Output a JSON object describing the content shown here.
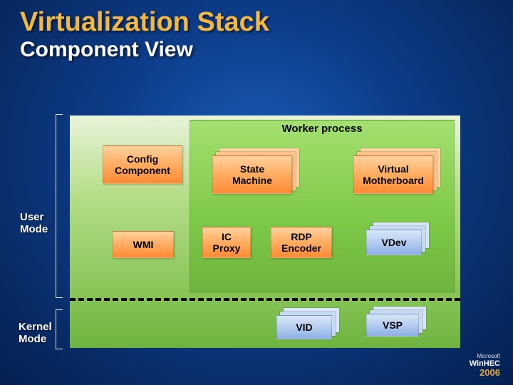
{
  "title": "Virtualization Stack",
  "subtitle": "Component View",
  "labels": {
    "user_mode_1": "User",
    "user_mode_2": "Mode",
    "kernel_mode_1": "Kernel",
    "kernel_mode_2": "Mode"
  },
  "worker": {
    "title": "Worker process",
    "state_machine": "State\nMachine",
    "virtual_mb": "Virtual\nMotherboard",
    "ic_proxy": "IC\nProxy",
    "rdp_encoder": "RDP\nEncoder",
    "vdev": "VDev"
  },
  "external": {
    "config_component": "Config\nComponent",
    "wmi": "WMI"
  },
  "kernel": {
    "vid": "VID",
    "vsp": "VSP"
  },
  "branding": {
    "vendor": "Microsoft",
    "product": "WinHEC",
    "year": "2006"
  }
}
